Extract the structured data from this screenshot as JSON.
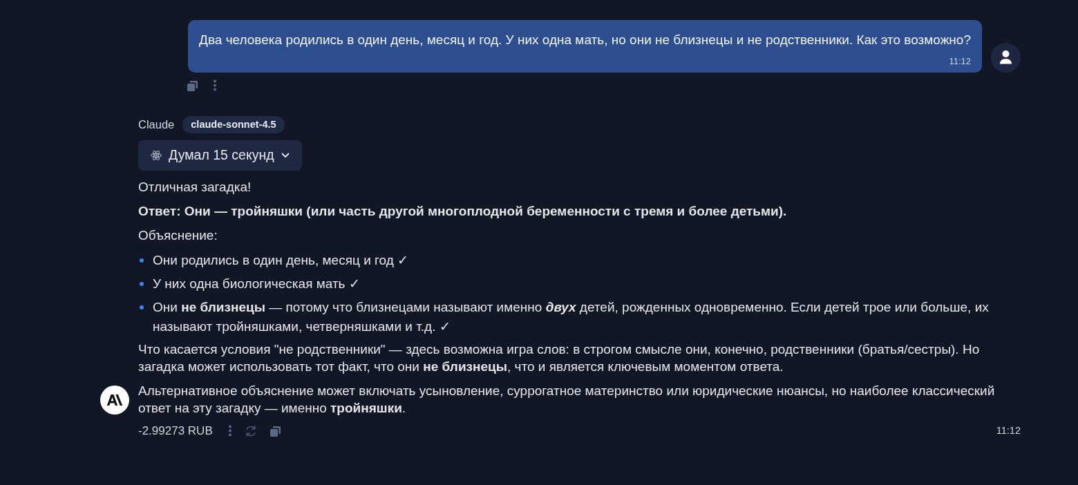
{
  "user_message": {
    "text": "Два человека родились в один день, месяц и год. У них одна мать, но они не близнецы и не родственники. Как это возможно?",
    "time": "11:12"
  },
  "assistant_message": {
    "sender": "Claude",
    "model": "claude-sonnet-4.5",
    "thinking": {
      "label": "Думал 15 секунд",
      "expanded": false
    },
    "content": [
      {
        "kind": "paragraph",
        "text": "Отличная загадка!"
      },
      {
        "kind": "bold_paragraph",
        "text": "Ответ: Они — тройняшки (или часть другой многоплодной беременности с тремя и более детьми)."
      },
      {
        "kind": "paragraph",
        "text": "Объяснение:"
      },
      {
        "kind": "bullet_list",
        "items": [
          "Они родились в один день, месяц и год ✓",
          "У них одна биологическая мать ✓",
          "Они **не близнецы** — потому что близнецами называют именно *двух* детей, рожденных одновременно. Если детей трое или больше, их называют тройняшками, четверняшками и т.д. ✓"
        ]
      },
      {
        "kind": "paragraph",
        "text": "Что касается условия \"не родственники\" — здесь возможна игра слов: в строгом смысле они, конечно, родственники (братья/сестры). Но загадка может использовать тот факт, что они **не близнецы**, что и является ключевым моментом ответа."
      },
      {
        "kind": "paragraph",
        "text": "Альтернативное объяснение может включать усыновление, суррогатное материнство или юридические нюансы, но наиболее классический ответ на эту загадку — именно **тройняшки**."
      }
    ],
    "cost": "-2.99273 RUB",
    "time": "11:12"
  }
}
